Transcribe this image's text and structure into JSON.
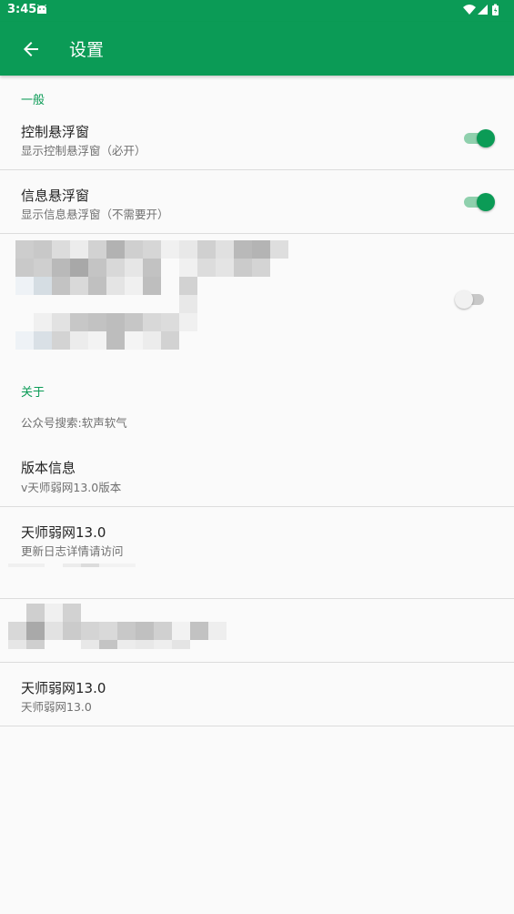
{
  "status_bar": {
    "time": "3:45",
    "icons": [
      "android-icon",
      "wifi-icon",
      "signal-icon",
      "battery-icon"
    ]
  },
  "app_bar": {
    "title": "设置",
    "back_icon": "arrow-left-icon"
  },
  "colors": {
    "accent": "#0b9b56",
    "switch_on_track": "#8fd0ad",
    "switch_off_track": "#c8c8c8",
    "background": "#fafafa"
  },
  "sections": {
    "general_header": "一般",
    "about_header": "关于"
  },
  "preferences": {
    "control_float": {
      "title": "控制悬浮窗",
      "summary": "显示控制悬浮窗（必开）",
      "enabled": true
    },
    "info_float": {
      "title": "信息悬浮窗",
      "summary": "显示信息悬浮窗（不需要开）",
      "enabled": true
    },
    "blurred_option": {
      "enabled": false
    },
    "wechat_search": {
      "text": "公众号搜索:软声软气"
    },
    "version_info": {
      "title": "版本信息",
      "summary": "v天师弱网13.0版本"
    },
    "changelog": {
      "title": "天师弱网13.0",
      "summary": "更新日志详情请访问"
    },
    "app_name_item": {
      "title": "天师弱网13.0",
      "summary": "天师弱网13.0"
    }
  }
}
